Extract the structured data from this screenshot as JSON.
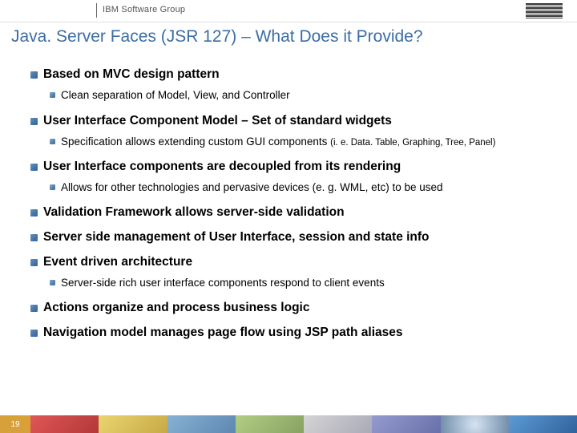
{
  "header": {
    "group": "IBM Software Group"
  },
  "title": "Java. Server Faces (JSR 127) – What Does it Provide?",
  "bullets": {
    "b1": "Based on MVC design pattern",
    "b1_1": "Clean separation of Model, View, and Controller",
    "b2": "User Interface Component Model – Set of standard widgets",
    "b2_1_main": "Specification allows extending custom GUI components ",
    "b2_1_paren": "(i. e. Data. Table, Graphing, Tree, Panel)",
    "b3": "User Interface components are decoupled from its rendering",
    "b3_1": "Allows for other technologies and pervasive devices (e. g. WML, etc) to be used",
    "b4": "Validation Framework allows server-side validation",
    "b5": "Server side management of User Interface, session and state info",
    "b6": "Event driven architecture",
    "b6_1": "Server-side rich user interface components respond to client events",
    "b7": "Actions organize and process business logic",
    "b8": "Navigation model manages page flow using JSP path aliases"
  },
  "footer": {
    "page": "19"
  }
}
